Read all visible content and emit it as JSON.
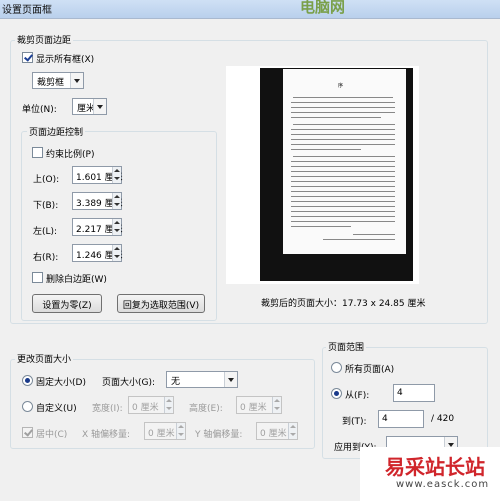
{
  "window": {
    "title": "设置页面框",
    "logo_text": "电脑网"
  },
  "crop_margins": {
    "legend": "裁剪页面边距",
    "show_all_boxes": {
      "label": "显示所有框(X)",
      "checked": true
    },
    "box_select": "裁剪框",
    "unit_label": "单位(N):",
    "unit_select": "厘米",
    "margin_control": {
      "legend": "页面边距控制",
      "constrain": {
        "label": "约束比例(P)",
        "checked": false
      },
      "top": {
        "label": "上(O):",
        "value": "1.601 厘米"
      },
      "bottom": {
        "label": "下(B):",
        "value": "3.389 厘米"
      },
      "left": {
        "label": "左(L):",
        "value": "2.217 厘米"
      },
      "right": {
        "label": "右(R):",
        "value": "1.246 厘米"
      },
      "remove_white": {
        "label": "删除白边距(W)",
        "checked": false
      },
      "set_zero_button": "设置为零(Z)",
      "revert_button": "回复为选取范围(V)"
    },
    "preview": {
      "heading": "序",
      "caption": "裁剪后的页面大小：17.73 x 24.85 厘米"
    }
  },
  "page_size": {
    "legend": "更改页面大小",
    "fixed": {
      "label": "固定大小(D)",
      "selected": true
    },
    "page_size_label": "页面大小(G):",
    "page_size_select": "无",
    "custom": {
      "label": "自定义(U)",
      "selected": false
    },
    "width": {
      "label": "宽度(I):",
      "value": "0 厘米"
    },
    "height": {
      "label": "高度(E):",
      "value": "0 厘米"
    },
    "center": {
      "label": "居中(C)",
      "checked": true
    },
    "x_offset": {
      "label": "X 轴偏移量:",
      "value": "0 厘米"
    },
    "y_offset": {
      "label": "Y 轴偏移量:",
      "value": "0 厘米"
    }
  },
  "page_range": {
    "legend": "页面范围",
    "all_pages": {
      "label": "所有页面(A)",
      "selected": false
    },
    "from": {
      "label": "从(F):",
      "value": "4",
      "selected": true
    },
    "to": {
      "label": "到(T):",
      "value": "4",
      "total": "/ 420"
    },
    "apply_to_label": "应用到(Y):"
  },
  "watermark": {
    "cn": "易采站长站",
    "url": "www.easck.com"
  }
}
